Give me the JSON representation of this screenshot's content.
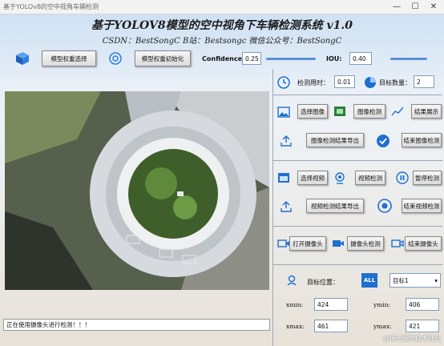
{
  "window": {
    "title": "基于YOLOv8的空中视角车辆检测",
    "minimize": "—",
    "maximize": "☐",
    "close": "✕"
  },
  "header": {
    "title": "基于YOLOV8模型的空中视角下车辆检测系统 v1.0",
    "subtitle": "CSDN：BestSongC   B站：Bestsongc   微信公众号：BestSongC"
  },
  "model": {
    "select_label": "模型权重选择",
    "init_label": "模型权重初始化"
  },
  "params": {
    "confidence_label": "Confidence:",
    "confidence_value": "0.25",
    "iou_label": "IOU:",
    "iou_value": "0.40",
    "confidence_level": 0.25,
    "iou_level": 0.4
  },
  "stats": {
    "time_label": "检测用时：",
    "time_value": "0.01",
    "count_label": "目标数量：",
    "count_value": "2"
  },
  "image_ops": {
    "select": "选择图像",
    "detect": "图像检测",
    "show": "结果展示",
    "export": "图像检测结果导出",
    "end": "结束图像检测"
  },
  "video_ops": {
    "select": "选择视频",
    "detect": "视频检测",
    "pause": "暂停检测",
    "export": "视频检测结果导出",
    "end": "结束视频检测"
  },
  "camera_ops": {
    "open": "打开摄像头",
    "detect": "摄像头检测",
    "end": "结束摄像头"
  },
  "target": {
    "label": "目标位置：",
    "all_badge": "ALL",
    "selected": "目标1",
    "xmin_label": "xmin:",
    "xmin": "424",
    "ymin_label": "ymin:",
    "ymin": "406",
    "xmax_label": "xmax:",
    "xmax": "461",
    "ymax_label": "ymax:",
    "ymax": "421"
  },
  "status": {
    "text": "正在使用摄像头进行检测！！！"
  },
  "watermark": "@稀土掘金技术社区",
  "colors": {
    "accent": "#1e6fd0",
    "icon_blue": "#2f7fe0"
  }
}
